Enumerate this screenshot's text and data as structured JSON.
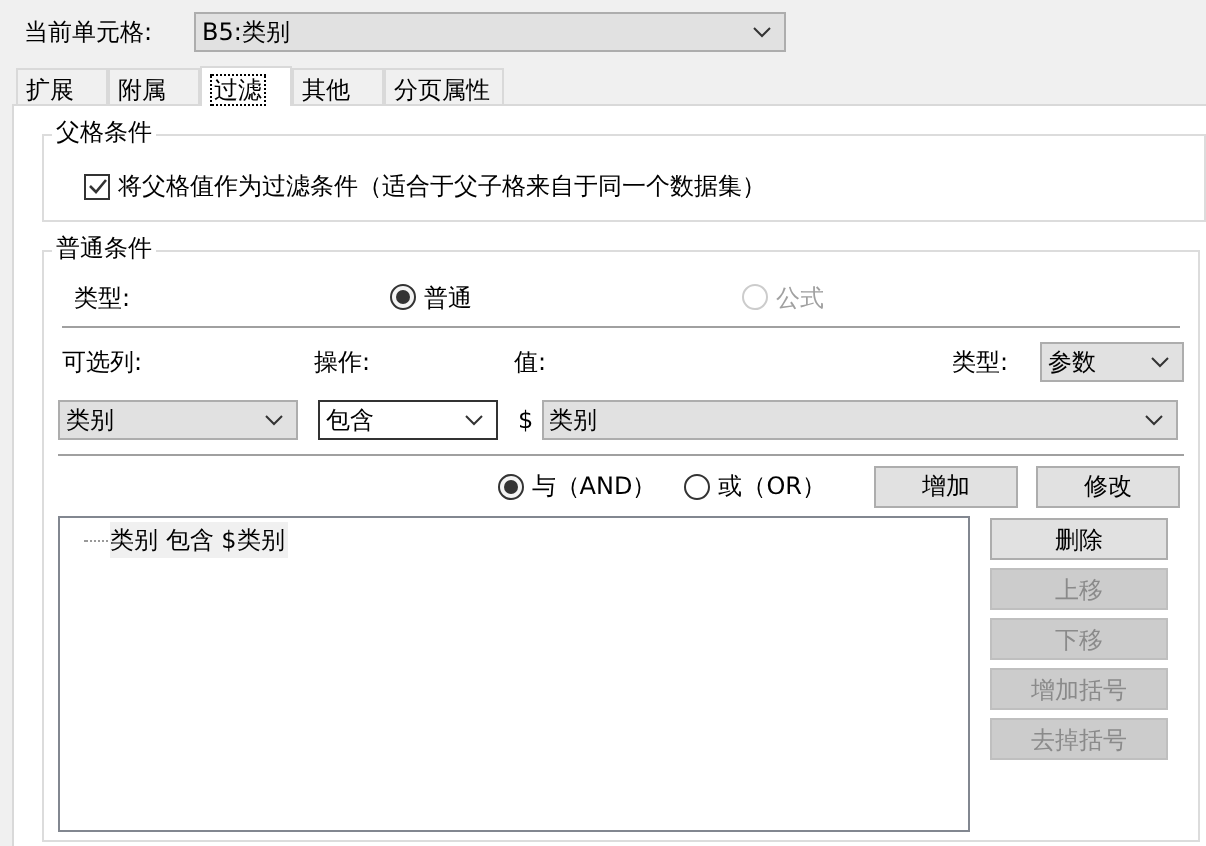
{
  "current_cell": {
    "label": "当前单元格:",
    "value": "B5:类别"
  },
  "tabs": [
    {
      "label": "扩展",
      "selected": false
    },
    {
      "label": "附属",
      "selected": false
    },
    {
      "label": "过滤",
      "selected": true
    },
    {
      "label": "其他",
      "selected": false
    },
    {
      "label": "分页属性",
      "selected": false
    }
  ],
  "parent_condition": {
    "title": "父格条件",
    "checkbox": {
      "label": "将父格值作为过滤条件（适合于父子格来自于同一个数据集）",
      "checked": true
    }
  },
  "normal_condition": {
    "title": "普通条件",
    "type_label": "类型:",
    "type_options": [
      {
        "label": "普通",
        "selected": true,
        "disabled": false
      },
      {
        "label": "公式",
        "selected": false,
        "disabled": true
      }
    ],
    "column_label": "可选列:",
    "operation_label": "操作:",
    "value_label": "值:",
    "value_type_label": "类型:",
    "value_type": "参数",
    "column": "类别",
    "operation": "包含",
    "value_prefix": "$",
    "value": "类别",
    "joins": [
      {
        "label": "与（AND）",
        "selected": true
      },
      {
        "label": "或（OR）",
        "selected": false
      }
    ],
    "top_buttons": [
      {
        "label": "增加",
        "disabled": false
      },
      {
        "label": "修改",
        "disabled": false
      }
    ],
    "conditions": [
      {
        "text": "类别 包含 $类别"
      }
    ],
    "side_buttons": [
      {
        "label": "删除",
        "disabled": false
      },
      {
        "label": "上移",
        "disabled": true
      },
      {
        "label": "下移",
        "disabled": true
      },
      {
        "label": "增加括号",
        "disabled": true
      },
      {
        "label": "去掉括号",
        "disabled": true
      }
    ]
  }
}
